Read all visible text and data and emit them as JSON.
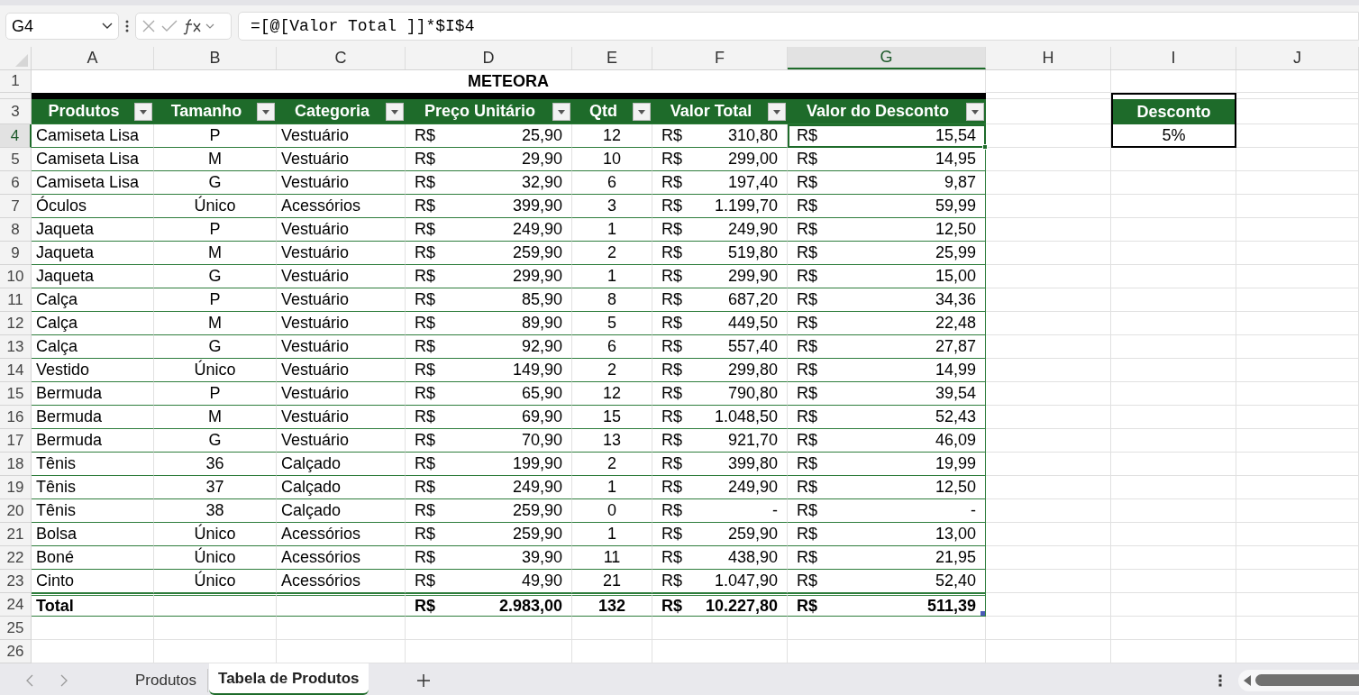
{
  "name_box": "G4",
  "formula": "=[@[Valor Total ]]*$I$4",
  "columns": [
    {
      "letter": "A",
      "selected": false
    },
    {
      "letter": "B",
      "selected": false
    },
    {
      "letter": "C",
      "selected": false
    },
    {
      "letter": "D",
      "selected": false
    },
    {
      "letter": "E",
      "selected": false
    },
    {
      "letter": "F",
      "selected": false
    },
    {
      "letter": "G",
      "selected": true
    },
    {
      "letter": "H",
      "selected": false
    },
    {
      "letter": "I",
      "selected": false
    },
    {
      "letter": "J",
      "selected": false
    }
  ],
  "row_numbers": [
    {
      "label": "1",
      "selected": false
    },
    {
      "label": "3",
      "selected": false
    },
    {
      "label": "4",
      "selected": true
    },
    {
      "label": "5",
      "selected": false
    },
    {
      "label": "6",
      "selected": false
    },
    {
      "label": "7",
      "selected": false
    },
    {
      "label": "8",
      "selected": false
    },
    {
      "label": "9",
      "selected": false
    },
    {
      "label": "10",
      "selected": false
    },
    {
      "label": "11",
      "selected": false
    },
    {
      "label": "12",
      "selected": false
    },
    {
      "label": "13",
      "selected": false
    },
    {
      "label": "14",
      "selected": false
    },
    {
      "label": "15",
      "selected": false
    },
    {
      "label": "16",
      "selected": false
    },
    {
      "label": "17",
      "selected": false
    },
    {
      "label": "18",
      "selected": false
    },
    {
      "label": "19",
      "selected": false
    },
    {
      "label": "20",
      "selected": false
    },
    {
      "label": "21",
      "selected": false
    },
    {
      "label": "22",
      "selected": false
    },
    {
      "label": "23",
      "selected": false
    },
    {
      "label": "24",
      "selected": false
    },
    {
      "label": "25",
      "selected": false
    },
    {
      "label": "26",
      "selected": false
    }
  ],
  "title": "METEORA",
  "table": {
    "headers": [
      "Produtos",
      "Tamanho",
      "Categoria",
      "Preço Unitário",
      "Qtd",
      "Valor Total",
      "Valor do Desconto"
    ],
    "rows": [
      [
        "Camiseta Lisa",
        "P",
        "Vestuário",
        [
          "R$",
          "25,90"
        ],
        "12",
        [
          "R$",
          "310,80"
        ],
        [
          "R$",
          "15,54"
        ]
      ],
      [
        "Camiseta Lisa",
        "M",
        "Vestuário",
        [
          "R$",
          "29,90"
        ],
        "10",
        [
          "R$",
          "299,00"
        ],
        [
          "R$",
          "14,95"
        ]
      ],
      [
        "Camiseta Lisa",
        "G",
        "Vestuário",
        [
          "R$",
          "32,90"
        ],
        "6",
        [
          "R$",
          "197,40"
        ],
        [
          "R$",
          "9,87"
        ]
      ],
      [
        "Óculos",
        "Único",
        "Acessórios",
        [
          "R$",
          "399,90"
        ],
        "3",
        [
          "R$",
          "1.199,70"
        ],
        [
          "R$",
          "59,99"
        ]
      ],
      [
        "Jaqueta",
        "P",
        "Vestuário",
        [
          "R$",
          "249,90"
        ],
        "1",
        [
          "R$",
          "249,90"
        ],
        [
          "R$",
          "12,50"
        ]
      ],
      [
        "Jaqueta",
        "M",
        "Vestuário",
        [
          "R$",
          "259,90"
        ],
        "2",
        [
          "R$",
          "519,80"
        ],
        [
          "R$",
          "25,99"
        ]
      ],
      [
        "Jaqueta",
        "G",
        "Vestuário",
        [
          "R$",
          "299,90"
        ],
        "1",
        [
          "R$",
          "299,90"
        ],
        [
          "R$",
          "15,00"
        ]
      ],
      [
        "Calça",
        "P",
        "Vestuário",
        [
          "R$",
          "85,90"
        ],
        "8",
        [
          "R$",
          "687,20"
        ],
        [
          "R$",
          "34,36"
        ]
      ],
      [
        "Calça",
        "M",
        "Vestuário",
        [
          "R$",
          "89,90"
        ],
        "5",
        [
          "R$",
          "449,50"
        ],
        [
          "R$",
          "22,48"
        ]
      ],
      [
        "Calça",
        "G",
        "Vestuário",
        [
          "R$",
          "92,90"
        ],
        "6",
        [
          "R$",
          "557,40"
        ],
        [
          "R$",
          "27,87"
        ]
      ],
      [
        "Vestido",
        "Único",
        "Vestuário",
        [
          "R$",
          "149,90"
        ],
        "2",
        [
          "R$",
          "299,80"
        ],
        [
          "R$",
          "14,99"
        ]
      ],
      [
        "Bermuda",
        "P",
        "Vestuário",
        [
          "R$",
          "65,90"
        ],
        "12",
        [
          "R$",
          "790,80"
        ],
        [
          "R$",
          "39,54"
        ]
      ],
      [
        "Bermuda",
        "M",
        "Vestuário",
        [
          "R$",
          "69,90"
        ],
        "15",
        [
          "R$",
          "1.048,50"
        ],
        [
          "R$",
          "52,43"
        ]
      ],
      [
        "Bermuda",
        "G",
        "Vestuário",
        [
          "R$",
          "70,90"
        ],
        "13",
        [
          "R$",
          "921,70"
        ],
        [
          "R$",
          "46,09"
        ]
      ],
      [
        "Tênis",
        "36",
        "Calçado",
        [
          "R$",
          "199,90"
        ],
        "2",
        [
          "R$",
          "399,80"
        ],
        [
          "R$",
          "19,99"
        ]
      ],
      [
        "Tênis",
        "37",
        "Calçado",
        [
          "R$",
          "249,90"
        ],
        "1",
        [
          "R$",
          "249,90"
        ],
        [
          "R$",
          "12,50"
        ]
      ],
      [
        "Tênis",
        "38",
        "Calçado",
        [
          "R$",
          "259,90"
        ],
        "0",
        [
          "R$",
          "-"
        ],
        [
          "R$",
          "-"
        ]
      ],
      [
        "Bolsa",
        "Único",
        "Acessórios",
        [
          "R$",
          "259,90"
        ],
        "1",
        [
          "R$",
          "259,90"
        ],
        [
          "R$",
          "13,00"
        ]
      ],
      [
        "Boné",
        "Único",
        "Acessórios",
        [
          "R$",
          "39,90"
        ],
        "11",
        [
          "R$",
          "438,90"
        ],
        [
          "R$",
          "21,95"
        ]
      ],
      [
        "Cinto",
        "Único",
        "Acessórios",
        [
          "R$",
          "49,90"
        ],
        "21",
        [
          "R$",
          "1.047,90"
        ],
        [
          "R$",
          "52,40"
        ]
      ]
    ],
    "total": {
      "label": "Total",
      "preco_unitario": [
        "R$",
        "2.983,00"
      ],
      "qtd": "132",
      "valor_total": [
        "R$",
        "10.227,80"
      ],
      "valor_do_desconto": [
        "R$",
        "511,39"
      ]
    }
  },
  "discount": {
    "header": "Desconto",
    "value": "5%"
  },
  "sheet_tabs": [
    {
      "label": "Produtos",
      "selected": false
    },
    {
      "label": "Tabela de Produtos",
      "selected": true
    }
  ]
}
